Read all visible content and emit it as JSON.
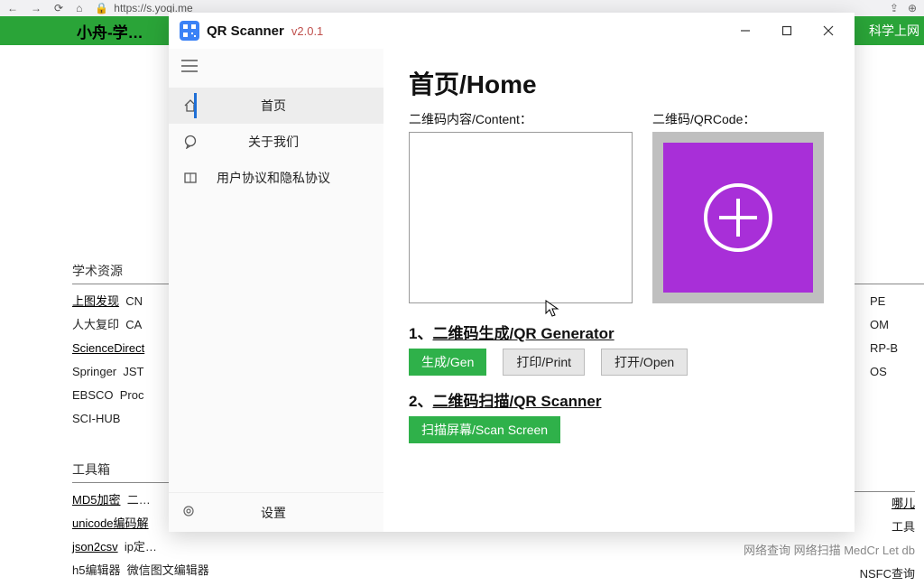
{
  "browser": {
    "url": "https://s.yoqi.me"
  },
  "bg": {
    "site_title": "小舟-学…",
    "vpn": "科学上网",
    "section_resources": "学术资源",
    "section_tools": "工具箱",
    "left_links": [
      "上图发现",
      "人大复印",
      "ScienceDirect",
      "Springer",
      "EBSCO",
      "SCI-HUB"
    ],
    "left_links2": [
      "CN",
      "CA",
      "JST",
      "Proc"
    ],
    "right_frag": [
      "PE",
      "OM",
      "RP-B",
      "OS"
    ],
    "tools_left": [
      "MD5加密",
      "unicode编码解",
      "json2csv",
      "h5编辑器"
    ],
    "tools_left2": [
      "二…",
      "ip定…",
      "微信图文编辑器"
    ],
    "tools_right_a": "哪儿",
    "tools_right_b": "工具",
    "tools_right_c": "网络查询   网络扫描   MedCr   Let  db",
    "tools_right_d": "NSFC查询"
  },
  "app": {
    "name": "QR Scanner",
    "version": "v2.0.1",
    "nav": {
      "home": "首页",
      "about": "关于我们",
      "privacy": "用户协议和隐私协议",
      "settings": "设置"
    },
    "page_title": "首页/Home",
    "content_label": "二维码内容/Content：",
    "qr_label": "二维码/QRCode：",
    "content_value": "",
    "sec1_prefix": "1、",
    "sec1_title": "二维码生成/QR Generator",
    "sec2_prefix": "2、",
    "sec2_title": "二维码扫描/QR Scanner",
    "btn_gen": "生成/Gen",
    "btn_print": "打印/Print",
    "btn_open": "打开/Open",
    "btn_scan": "扫描屏幕/Scan Screen"
  }
}
